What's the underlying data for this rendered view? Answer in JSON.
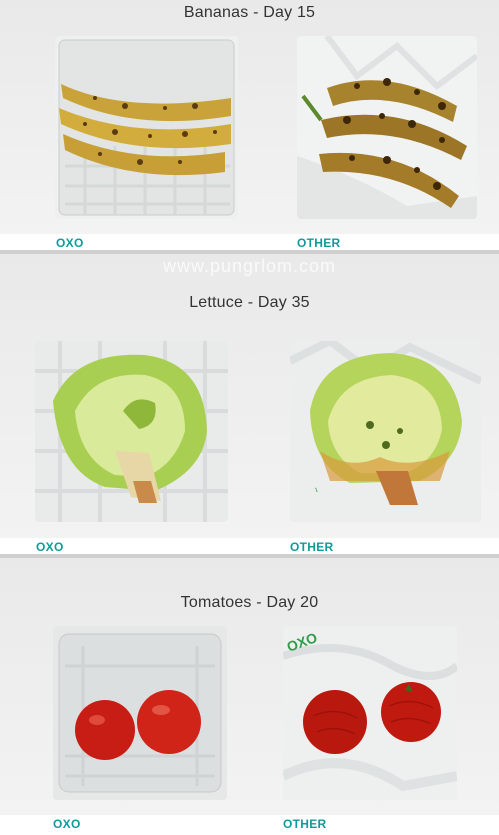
{
  "watermark": "www.pungrlom.com",
  "panels": [
    {
      "title": "Bananas - Day 15",
      "left_label": "OXO",
      "right_label": "OTHER"
    },
    {
      "title": "Lettuce - Day 35",
      "left_label": "OXO",
      "right_label": "OTHER"
    },
    {
      "title": "Tomatoes - Day 20",
      "left_label": "OXO",
      "right_label": "OTHER"
    }
  ],
  "bag_print": "OXO"
}
